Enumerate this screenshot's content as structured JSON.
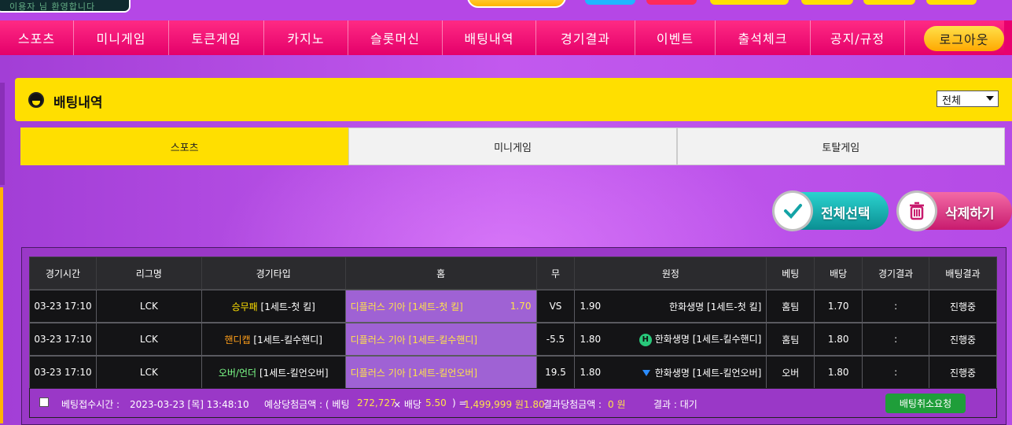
{
  "top": {
    "login_hint": "이용자 님 환영합니다",
    "logo_text": "슬롯머신"
  },
  "nav": {
    "items": [
      "스포츠",
      "미니게임",
      "토큰게임",
      "카지노",
      "슬롯머신",
      "배팅내역",
      "경기결과",
      "이벤트",
      "출석체크",
      "공지/규정"
    ],
    "logout": "로그아웃"
  },
  "panel": {
    "title": "배팅내역",
    "filter_value": "전체"
  },
  "tabs": [
    "스포츠",
    "미니게임",
    "토탈게임"
  ],
  "actions": {
    "select_all": "전체선택",
    "delete": "삭제하기"
  },
  "table": {
    "headers": [
      "경기시간",
      "리그명",
      "경기타입",
      "홈",
      "무",
      "원정",
      "베팅",
      "배당",
      "경기결과",
      "배팅결과"
    ],
    "rows": [
      {
        "time": "03-23 17:10",
        "league": "LCK",
        "type_main": "승무패",
        "type_sub": "[1세트-첫 킬]",
        "home": "디플러스 기아 [1세트-첫 킬]",
        "home_odds": "1.70",
        "draw": "VS",
        "away_odds": "1.90",
        "away": "한화생명 [1세트-첫 킬]",
        "bet": "홈팀",
        "rate": "1.70",
        "result": ":",
        "bet_result": "진행중"
      },
      {
        "time": "03-23 17:10",
        "league": "LCK",
        "type_main": "핸디캡",
        "type_sub": "[1세트-킬수핸디]",
        "home": "디플러스 기아 [1세트-킬수핸디]",
        "home_odds": "",
        "draw": "-5.5",
        "away_odds": "1.80",
        "away_badge": "H",
        "away": "한화생명 [1세트-킬수핸디]",
        "bet": "홈팀",
        "rate": "1.80",
        "result": ":",
        "bet_result": "진행중"
      },
      {
        "time": "03-23 17:10",
        "league": "LCK",
        "type_main": "오버/언더",
        "type_sub": "[1세트-킬언오버]",
        "home": "디플러스 기아 [1세트-킬언오버]",
        "home_odds": "",
        "draw": "19.5",
        "away_odds": "1.80",
        "away": "한화생명 [1세트-킬언오버]",
        "bet": "오버",
        "rate": "1.80",
        "result": ":",
        "bet_result": "진행중"
      }
    ]
  },
  "summary": {
    "bet_time_label": "베팅접수시간 :",
    "bet_time": "2023-03-23 [목] 13:48:10",
    "expected_label": "예상당첨금액 : ( 베팅",
    "stake": "272,727",
    "times_label": "× 배당",
    "total_rate": "5.50",
    "equals_label": ") =",
    "expected_amount": "1,499,999 원1.80",
    "result_amount_label": "결과당첨금액 :",
    "result_amount": "0 원",
    "result_label": "결과 : 대기",
    "cancel_button": "배팅취소요청"
  },
  "colors": {
    "nav": "#e4006a",
    "accent_yellow": "#ffdf00",
    "page_bg": "#b547e6",
    "cancel_green": "#1f9e3a",
    "select_all": "#0b8f93",
    "delete": "#c81b6e"
  }
}
